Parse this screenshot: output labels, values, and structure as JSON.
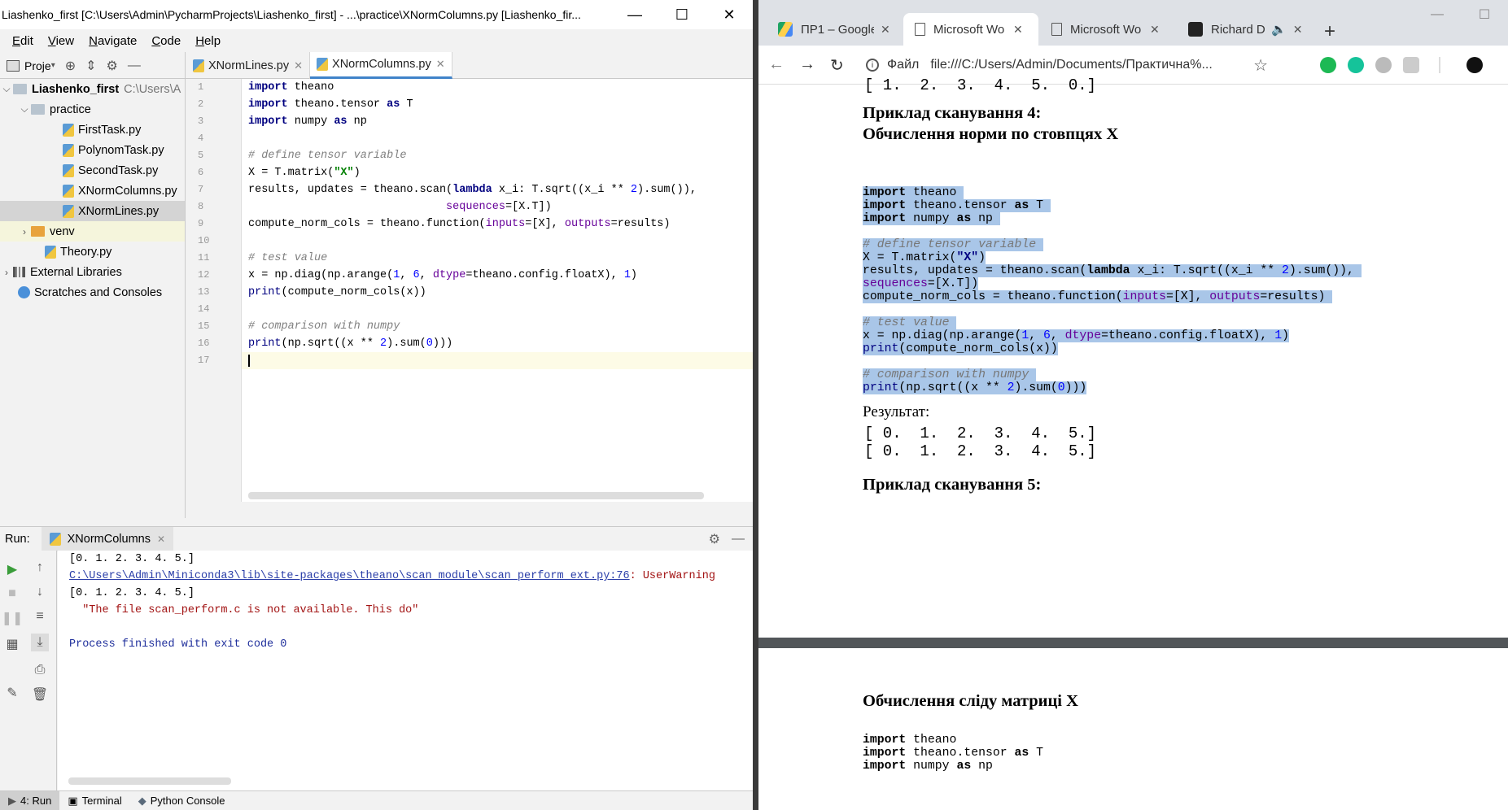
{
  "ide": {
    "title": "Liashenko_first [C:\\Users\\Admin\\PycharmProjects\\Liashenko_first] - ...\\practice\\XNormColumns.py [Liashenko_fir...",
    "window_buttons": {
      "minimize": "—",
      "maximize": "☐",
      "close": "✕"
    },
    "menu": [
      {
        "u": "E",
        "rest": "dit"
      },
      {
        "u": "V",
        "rest": "iew"
      },
      {
        "u": "N",
        "rest": "avigate"
      },
      {
        "u": "C",
        "rest": "ode"
      },
      {
        "u": "H",
        "rest": "elp"
      }
    ],
    "project_label": "Proje",
    "tabs": [
      {
        "label": "XNormLines.py",
        "active": false
      },
      {
        "label": "XNormColumns.py",
        "active": true
      }
    ],
    "tree": {
      "root": {
        "name": "Liashenko_first",
        "path": "C:\\Users\\A"
      },
      "practice": "practice",
      "files": [
        "FirstTask.py",
        "PolynomTask.py",
        "SecondTask.py",
        "XNormColumns.py",
        "XNormLines.py"
      ],
      "venv": "venv",
      "theory": "Theory.py",
      "external": "External Libraries",
      "scratches": "Scratches and Consoles"
    },
    "line_numbers": [
      "1",
      "2",
      "3",
      "4",
      "5",
      "6",
      "7",
      "8",
      "9",
      "10",
      "11",
      "12",
      "13",
      "14",
      "15",
      "16",
      "17"
    ],
    "run": {
      "label": "Run:",
      "tab": "XNormColumns",
      "output": [
        {
          "type": "plain",
          "text": "[0. 1. 2. 3. 4. 5.]"
        },
        {
          "type": "link",
          "text": "C:\\Users\\Admin\\Miniconda3\\lib\\site-packages\\theano\\scan_module\\scan_perform_ext.py:76",
          "suffix": ": UserWarning"
        },
        {
          "type": "plain",
          "text": "[0. 1. 2. 3. 4. 5.]"
        },
        {
          "type": "err",
          "text": "  \"The file scan_perform.c is not available. This do\""
        },
        {
          "type": "plain",
          "text": ""
        },
        {
          "type": "blue",
          "text": "Process finished with exit code 0"
        }
      ]
    },
    "statusbar": [
      {
        "label": "4: Run",
        "on": true
      },
      {
        "label": "Terminal",
        "on": false
      },
      {
        "label": "Python Console",
        "on": false
      }
    ]
  },
  "browser": {
    "tabs": [
      {
        "label": "ПР1 – Google",
        "fav_color": "#1fa463",
        "active": false
      },
      {
        "label": "Microsoft Wo",
        "fav_color": "#ffffff",
        "active": true
      },
      {
        "label": "Microsoft Wo",
        "fav_color": "#ffffff",
        "active": false
      },
      {
        "label": "Richard D",
        "fav_color": "#222222",
        "active": false
      }
    ],
    "new_tab": "+",
    "address": {
      "protocol": "Файл",
      "url": "file:///C:/Users/Admin/Documents/Практична%..."
    },
    "doc": {
      "top_result": "[ 1.  2.  3.  4.  5.  0.]",
      "heading4_line1": "Приклад сканування 4:",
      "heading4_line2": "Обчислення норми по стовпцях X",
      "result_label": "Результат:",
      "result_lines": [
        "[ 0.  1.  2.  3.  4.  5.]",
        "[ 0.  1.  2.  3.  4.  5.]"
      ],
      "heading5": "Приклад сканування 5:",
      "heading_trace": "Обчислення сліду матриці X",
      "code2": [
        "import theano",
        "import theano.tensor as T",
        "import numpy as np"
      ]
    }
  },
  "colors": {
    "accent": "#4083c9",
    "selection": "#a9c6e8",
    "viewer_bg": "#525659"
  }
}
